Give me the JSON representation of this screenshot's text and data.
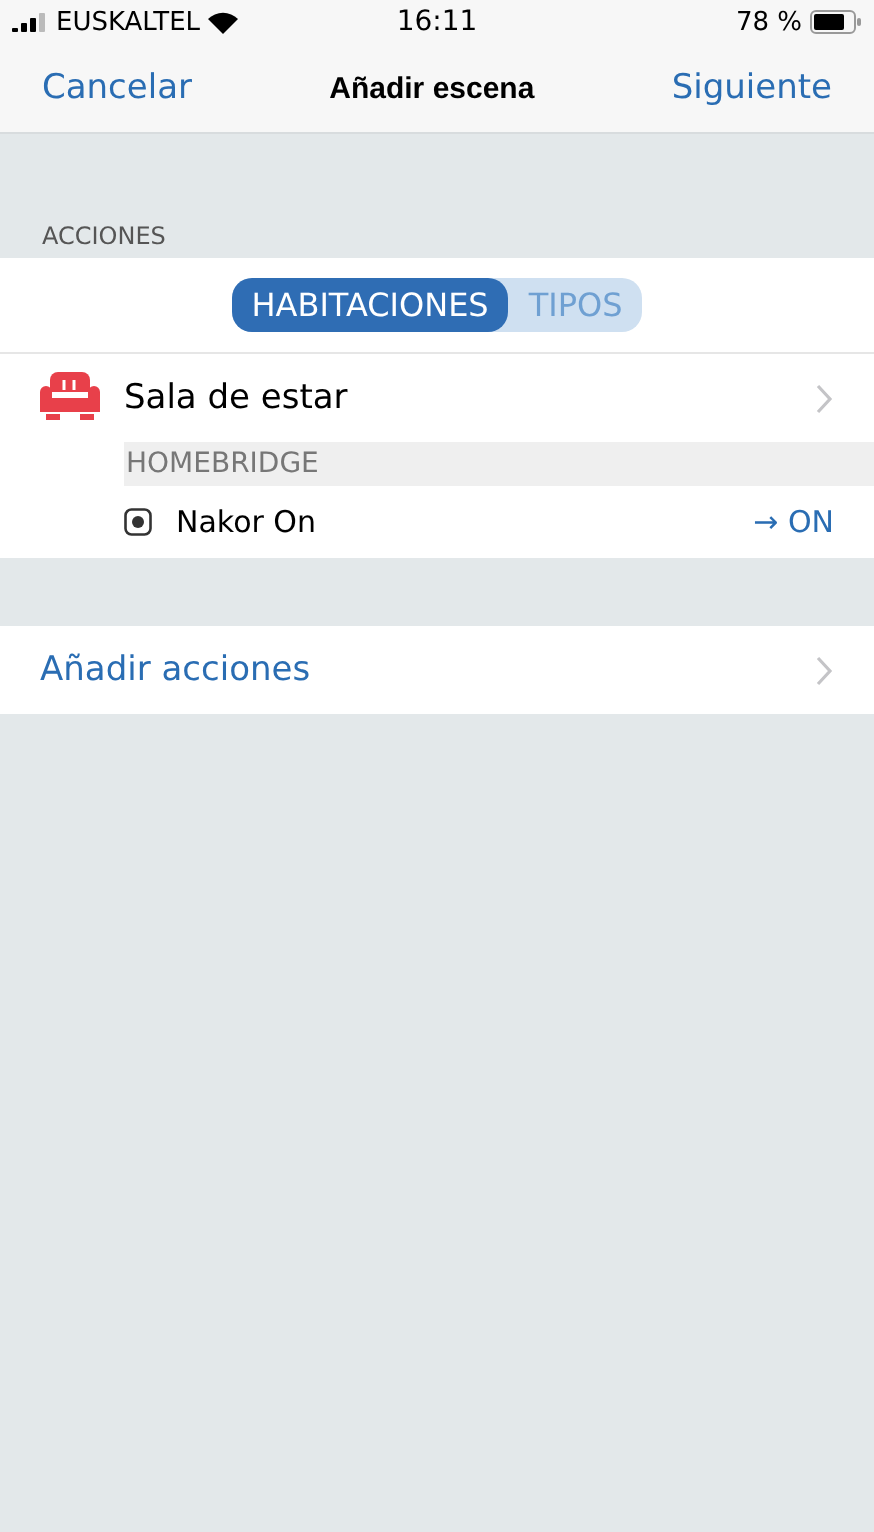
{
  "status_bar": {
    "carrier": "EUSKALTEL",
    "time": "16:11",
    "battery": "78 %"
  },
  "nav": {
    "cancel": "Cancelar",
    "title": "Añadir escena",
    "next": "Siguiente"
  },
  "section": {
    "header": "ACCIONES"
  },
  "segments": [
    {
      "label": "HABITACIONES",
      "selected": true
    },
    {
      "label": "TIPOS",
      "selected": false
    }
  ],
  "room": {
    "name": "Sala de estar",
    "groups": [
      {
        "header": "HOMEBRIDGE",
        "items": [
          {
            "name": "Nakor On",
            "action": "→ ON"
          }
        ]
      }
    ]
  },
  "add_actions": "Añadir acciones"
}
